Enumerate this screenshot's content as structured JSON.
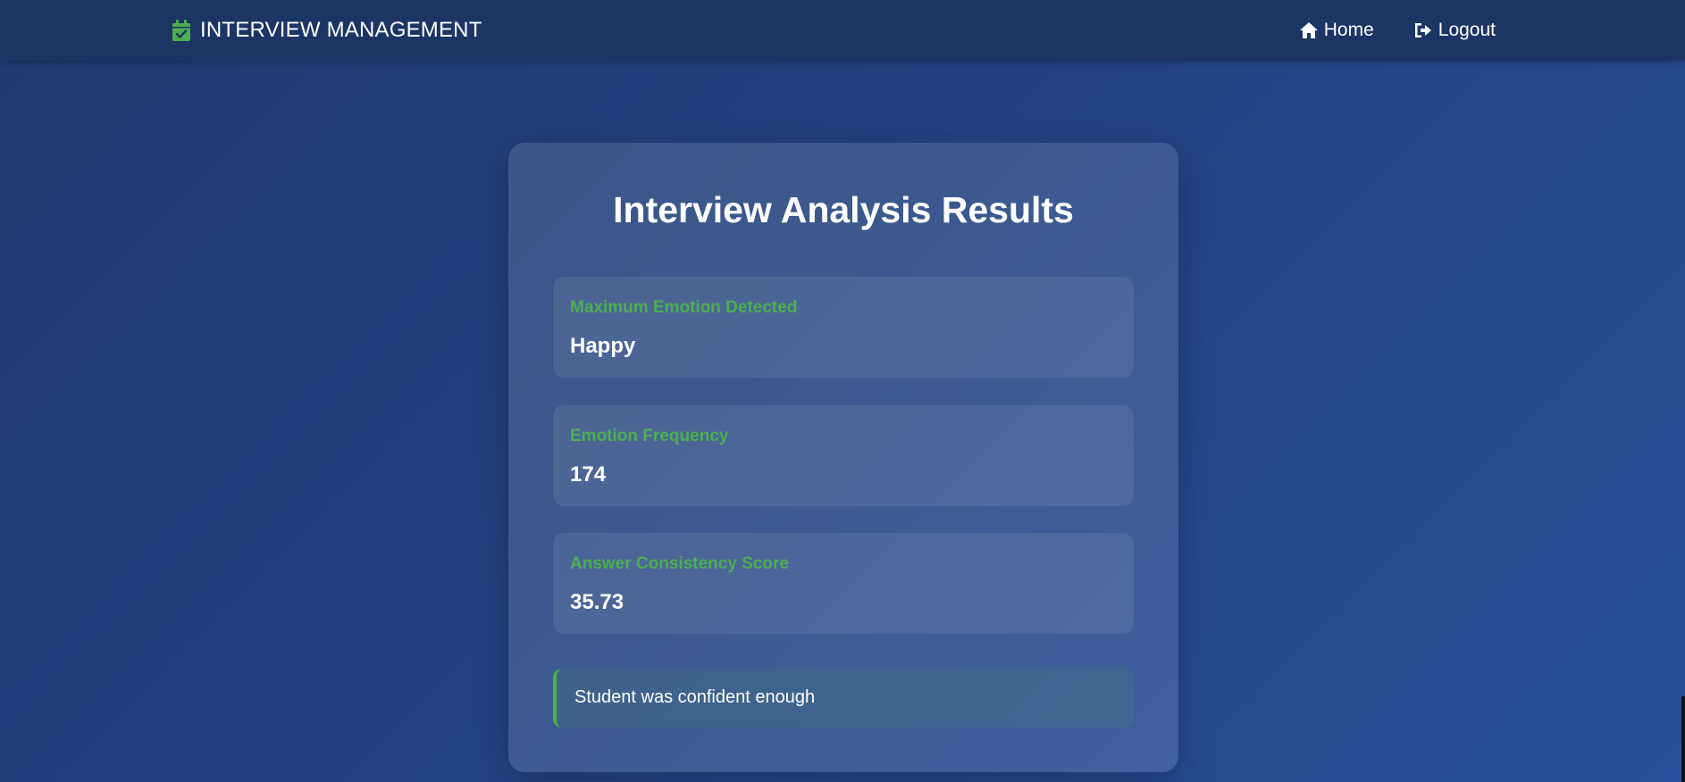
{
  "navbar": {
    "brand": "INTERVIEW MANAGEMENT",
    "brand_icon": "calendar-check-icon",
    "links": [
      {
        "label": "Home",
        "icon": "home-icon"
      },
      {
        "label": "Logout",
        "icon": "sign-out-icon"
      }
    ]
  },
  "card": {
    "title": "Interview Analysis Results",
    "results": [
      {
        "label": "Maximum Emotion Detected",
        "value": "Happy"
      },
      {
        "label": "Emotion Frequency",
        "value": "174"
      },
      {
        "label": "Answer Consistency Score",
        "value": "35.73"
      }
    ],
    "remark": "Student was confident enough"
  },
  "colors": {
    "accent": "#4caf50",
    "navbar": "#1c3565",
    "background": "#22427f"
  }
}
